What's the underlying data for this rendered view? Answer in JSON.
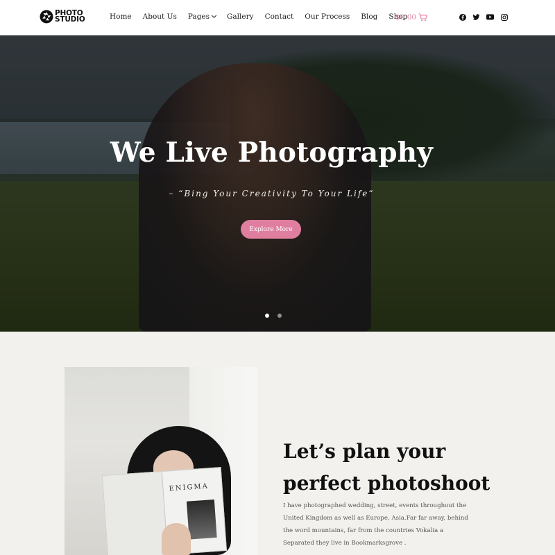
{
  "header": {
    "logo_line1": "PHOTO",
    "logo_line2": "STUDIO",
    "nav": [
      {
        "label": "Home"
      },
      {
        "label": "About Us"
      },
      {
        "label": "Pages"
      },
      {
        "label": "Gallery"
      },
      {
        "label": "Contact"
      },
      {
        "label": "Our Process"
      },
      {
        "label": "Blog"
      },
      {
        "label": "Shop"
      }
    ],
    "cart_total": "$0.00",
    "social": [
      "facebook-icon",
      "twitter-icon",
      "youtube-icon",
      "instagram-icon"
    ]
  },
  "hero": {
    "title": "We Live Photography",
    "subtitle": "– “Bing Your Creativity To Your Life“",
    "button_label": "Explore More",
    "active_slide": 1,
    "slide_count": 2
  },
  "intro": {
    "heading_line1": "Let’s plan your",
    "heading_line2": "perfect photoshoot",
    "body": "I have photographed wedding, street, events throughout the United Kingdom as well as Europe, Asia.Far far away, behind the word mountains, far from the countries Vokalia a Separated they live in Bookmarksgrove .",
    "photo_book_title": "ENIGMA"
  },
  "colors": {
    "accent": "#e07ea0",
    "background": "#f3f1ee",
    "header_bg": "#ffffff"
  }
}
